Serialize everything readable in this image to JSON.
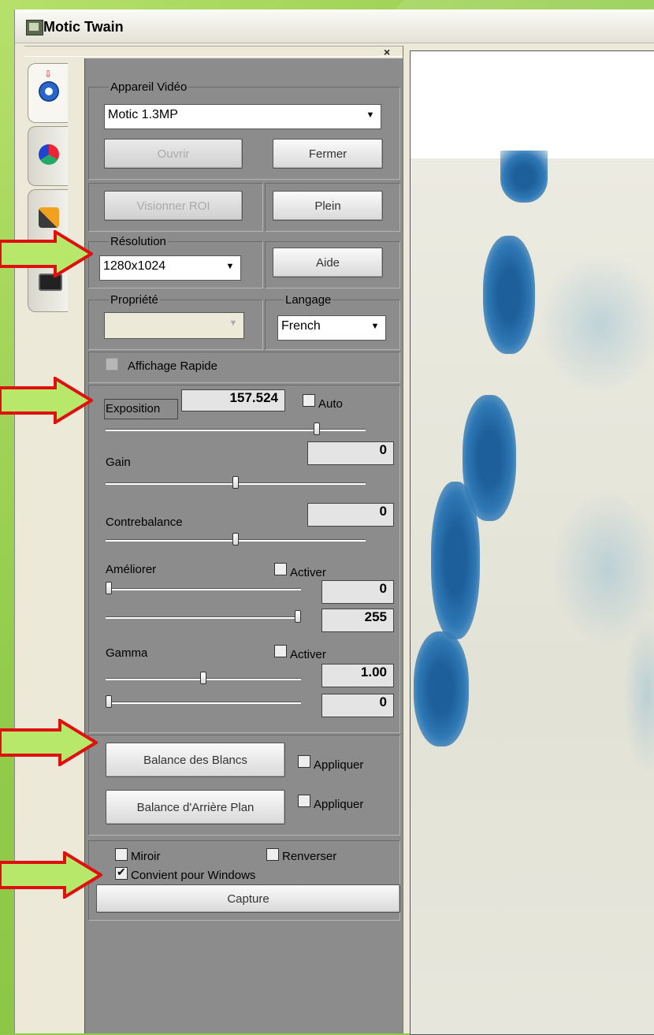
{
  "window": {
    "title": "Motic Twain"
  },
  "strip": {
    "close": "×"
  },
  "tabs": [
    {
      "icon": "settings-gear-icon",
      "active": true
    },
    {
      "icon": "color-wheel-icon",
      "active": false
    },
    {
      "icon": "tools-icon",
      "active": false
    },
    {
      "icon": "camera-icon",
      "active": false
    }
  ],
  "device": {
    "group_label": "Appareil Vidéo",
    "selected": "Motic 1.3MP",
    "open_label": "Ouvrir",
    "close_label": "Fermer"
  },
  "roi": {
    "view_roi_label": "Visionner ROI",
    "full_label": "Plein"
  },
  "resolution": {
    "group_label": "Résolution",
    "selected": "1280x1024",
    "help_label": "Aide"
  },
  "property": {
    "group_label": "Propriété",
    "selected": ""
  },
  "language": {
    "group_label": "Langage",
    "selected": "French"
  },
  "fast_display": {
    "label": "Affichage Rapide",
    "checked": false
  },
  "exposure": {
    "label": "Exposition",
    "value": "157.524",
    "auto_label": "Auto",
    "auto_checked": false,
    "level": 0.82
  },
  "gain": {
    "label": "Gain",
    "value": "0",
    "level": 0.5
  },
  "contrast": {
    "label": "Contrebalance",
    "value": "0",
    "level": 0.5
  },
  "enhance": {
    "label": "Améliorer",
    "activate_label": "Activer",
    "activate_checked": false,
    "low": "0",
    "high": "255",
    "low_level": 0.0,
    "high_level": 1.0
  },
  "gamma": {
    "label": "Gamma",
    "activate_label": "Activer",
    "activate_checked": false,
    "value": "1.00",
    "offset": "0",
    "value_level": 0.5,
    "offset_level": 0.0
  },
  "white_balance": {
    "label": "Balance des Blancs",
    "apply_label": "Appliquer",
    "apply_checked": false
  },
  "background_balance": {
    "label": "Balance d'Arrière Plan",
    "apply_label": "Appliquer",
    "apply_checked": false
  },
  "options": {
    "mirror_label": "Miroir",
    "mirror_checked": false,
    "flip_label": "Renverser",
    "flip_checked": false,
    "windows_label": "Convient pour Windows",
    "windows_checked": true
  },
  "capture": {
    "label": "Capture"
  },
  "colors": {
    "annotation_arrow_fill": "#b7e86a",
    "annotation_arrow_stroke": "#e01010",
    "panel_gray": "#8c8c8c"
  }
}
